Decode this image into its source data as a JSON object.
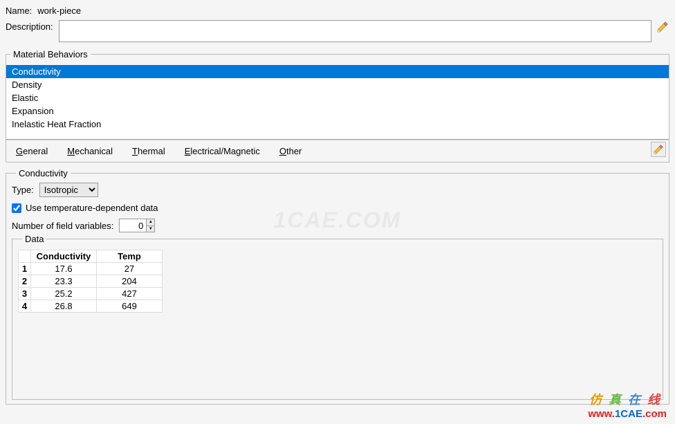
{
  "header": {
    "name_label": "Name:",
    "name_value": "work-piece",
    "description_label": "Description:",
    "description_value": ""
  },
  "behaviors": {
    "legend": "Material Behaviors",
    "items": [
      "Conductivity",
      "Density",
      "Elastic",
      "Expansion",
      "Inelastic Heat Fraction"
    ],
    "selected_index": 0
  },
  "menu": {
    "items": [
      {
        "pre": "",
        "u": "G",
        "post": "eneral"
      },
      {
        "pre": "",
        "u": "M",
        "post": "echanical"
      },
      {
        "pre": "",
        "u": "T",
        "post": "hermal"
      },
      {
        "pre": "",
        "u": "E",
        "post": "lectrical/Magnetic"
      },
      {
        "pre": "",
        "u": "O",
        "post": "ther"
      }
    ]
  },
  "conductivity": {
    "legend": "Conductivity",
    "type_label": "Type:",
    "type_value": "Isotropic",
    "temp_dep_checked": true,
    "temp_dep_label": "Use temperature-dependent data",
    "fv_label": "Number of field variables:",
    "fv_value": "0"
  },
  "data": {
    "legend": "Data",
    "columns": [
      "Conductivity",
      "Temp"
    ],
    "rows": [
      {
        "n": "1",
        "c": "17.6",
        "t": "27"
      },
      {
        "n": "2",
        "c": "23.3",
        "t": "204"
      },
      {
        "n": "3",
        "c": "25.2",
        "t": "427"
      },
      {
        "n": "4",
        "c": "26.8",
        "t": "649"
      }
    ]
  },
  "watermark": {
    "center": "1CAE.COM",
    "cn": "仿真在线",
    "url_pre": "www.",
    "url_mid": "1CAE",
    "url_post": ".com"
  }
}
